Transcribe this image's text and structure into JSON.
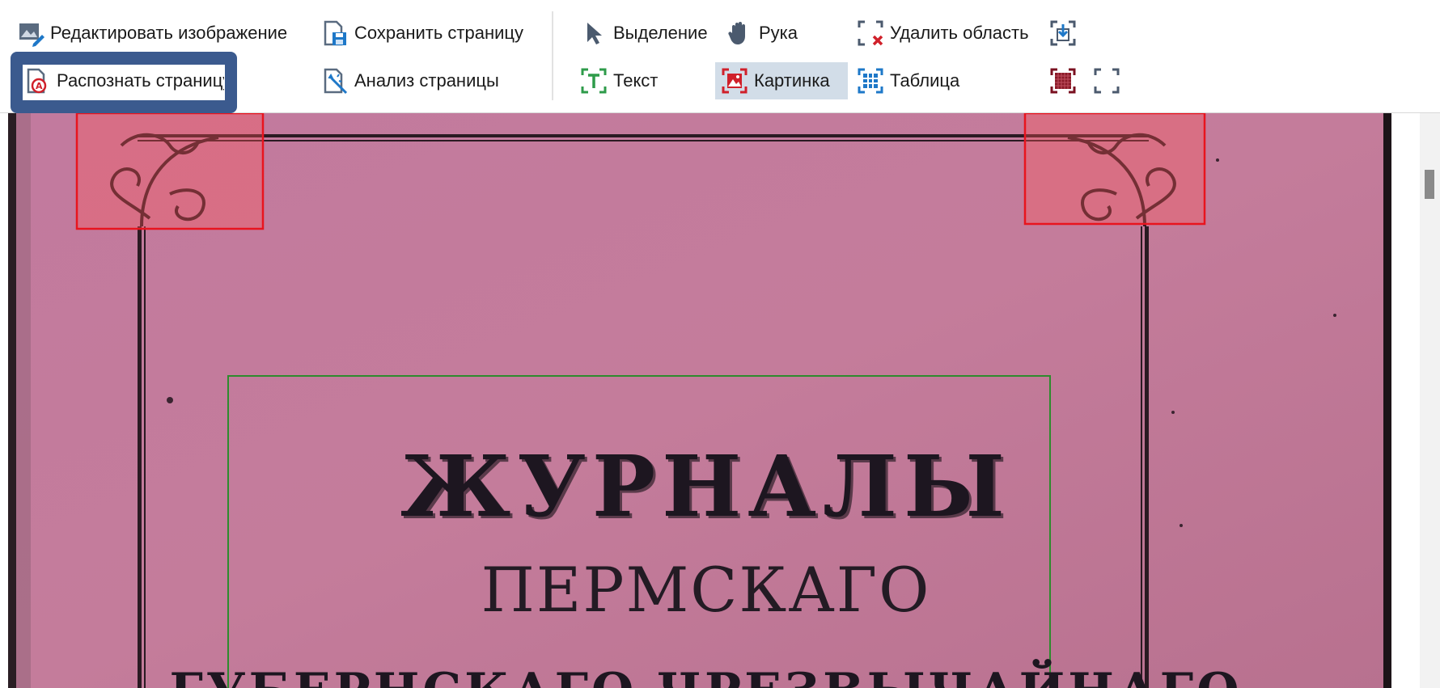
{
  "toolbar": {
    "edit_image": "Редактировать изображение",
    "save_page": "Сохранить страницу",
    "recognize_page": "Распознать страницу",
    "analyze_page": "Анализ страницы",
    "selection": "Выделение",
    "hand": "Рука",
    "delete_area": "Удалить область",
    "text": "Текст",
    "picture": "Картинка",
    "table": "Таблица"
  },
  "document": {
    "line1": "ЖУРНАЛЫ",
    "line2": "ПЕРМСКАГО",
    "line3": "ГУБЕРНСКАГО ЧРЕЗВЫЧАЙНАГО"
  },
  "colors": {
    "recognize_highlight": "#3b5a8e",
    "picture_region": "#e8141e",
    "text_region": "#2e8b2e",
    "page_paper": "#c07a9a"
  },
  "icons": {
    "edit_image": "edit-image-icon",
    "save_page": "save-page-icon",
    "recognize_page": "recognize-page-icon",
    "analyze_page": "analyze-page-icon",
    "selection": "cursor-arrow-icon",
    "hand": "hand-icon",
    "delete_area": "delete-area-icon",
    "text": "text-area-icon",
    "picture": "picture-area-icon",
    "table": "table-area-icon",
    "import_area": "import-area-icon",
    "background_area": "background-area-icon",
    "empty_area": "empty-area-icon"
  }
}
